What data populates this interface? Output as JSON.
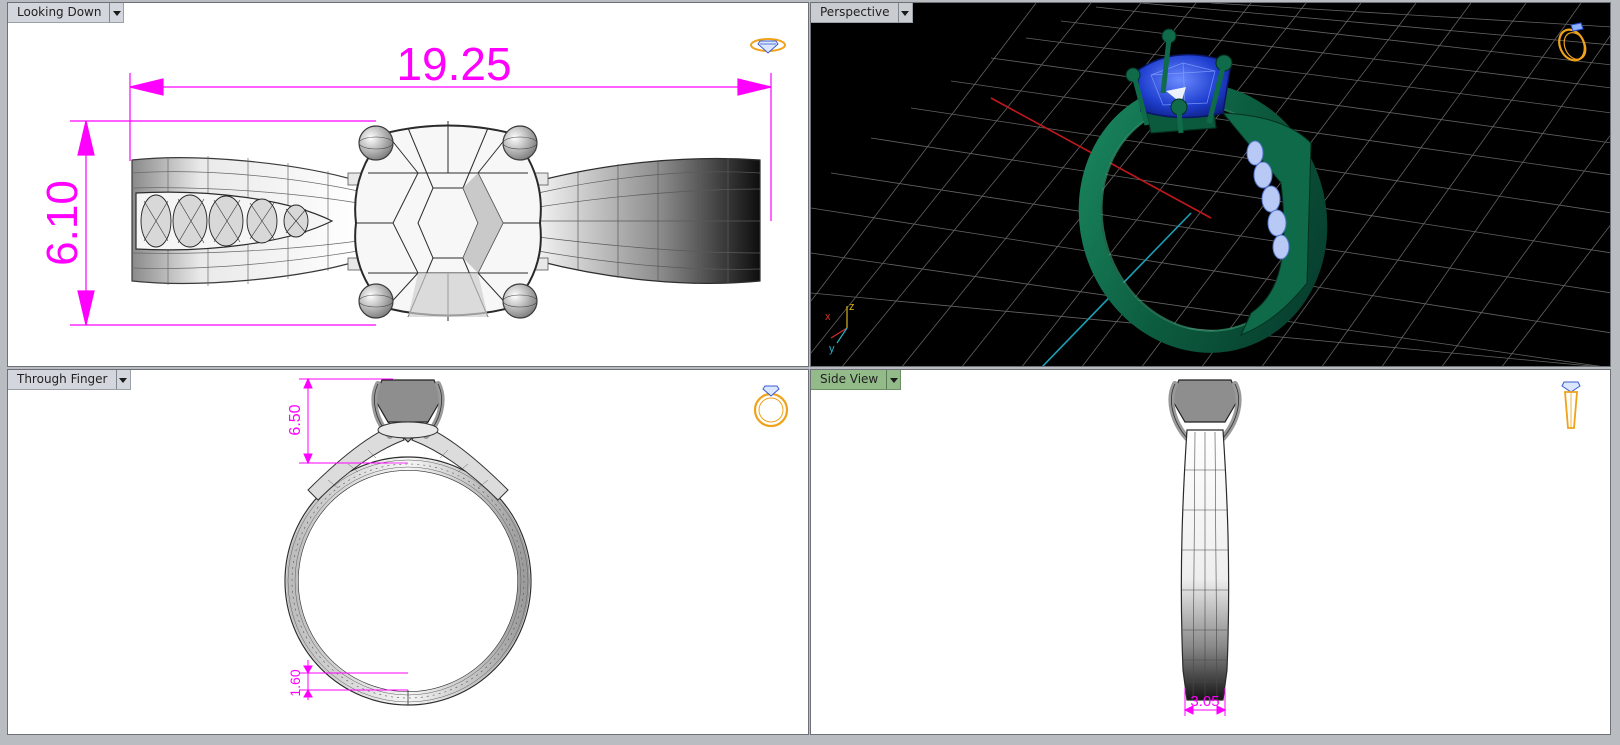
{
  "viewports": {
    "top_left": {
      "label": "Looking Down",
      "dimensions": {
        "width": "19.25",
        "height": "6.10"
      }
    },
    "top_right": {
      "label": "Perspective",
      "axis_labels": {
        "x": "x",
        "y": "y",
        "z": "z"
      }
    },
    "bottom_left": {
      "label": "Through Finger",
      "dimensions": {
        "setting_height": "6.50",
        "shank_thickness": "1.60"
      }
    },
    "bottom_right": {
      "label": "Side View",
      "dimensions": {
        "shank_width": "3.05"
      }
    }
  },
  "colors": {
    "dimension": "#ff00ff",
    "perspective_background": "#000000",
    "ring_metal_perspective": "#0f6b4a",
    "center_stone": "#1f3fd0",
    "grid_x_axis": "#c0181a",
    "grid_y_axis": "#1aa0b6",
    "active_tab": "#93bb8a"
  },
  "icons": {
    "top_left": "ring-top-icon",
    "top_right": "ring-perspective-icon",
    "bottom_left": "ring-front-icon",
    "bottom_right": "ring-side-icon"
  }
}
